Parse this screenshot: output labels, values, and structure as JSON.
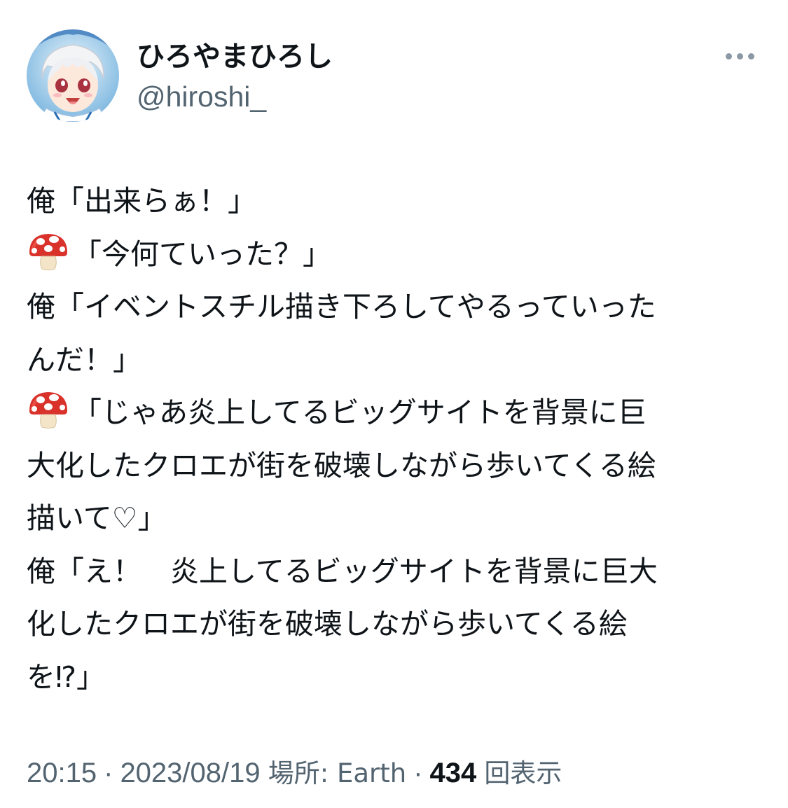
{
  "author": {
    "display_name": "ひろやまひろし",
    "handle": "@hiroshi_",
    "avatar": "anime-avatar-icon"
  },
  "more_menu": {
    "icon": "more-horizontal-icon"
  },
  "tweet": {
    "lines": [
      {
        "emoji": false,
        "text": "俺「出来らぁ！」"
      },
      {
        "emoji": true,
        "text": "「今何ていった？」"
      },
      {
        "emoji": false,
        "text": "俺「イベントスチル描き下ろしてやるっていった"
      },
      {
        "emoji": false,
        "text": "んだ！」"
      },
      {
        "emoji": true,
        "text": "「じゃあ炎上してるビッグサイトを背景に巨"
      },
      {
        "emoji": false,
        "text": "大化したクロエが街を破壊しながら歩いてくる絵"
      },
      {
        "emoji": false,
        "text": "描いて♡」"
      },
      {
        "emoji": false,
        "text": "俺「え！　炎上してるビッグサイトを背景に巨大"
      },
      {
        "emoji": false,
        "text": "化したクロエが街を破壊しながら歩いてくる絵"
      },
      {
        "emoji": false,
        "text": "を⁉」"
      }
    ],
    "emoji_icon": "mushroom-emoji-icon"
  },
  "meta": {
    "time": "20:15",
    "date": "2023/08/19",
    "location_label": "場所: Earth",
    "views_count": "434",
    "views_label": "回表示",
    "separator": "·"
  },
  "colors": {
    "text_primary": "#0f1419",
    "text_secondary": "#536471",
    "icon_gray": "#8b98a5"
  }
}
